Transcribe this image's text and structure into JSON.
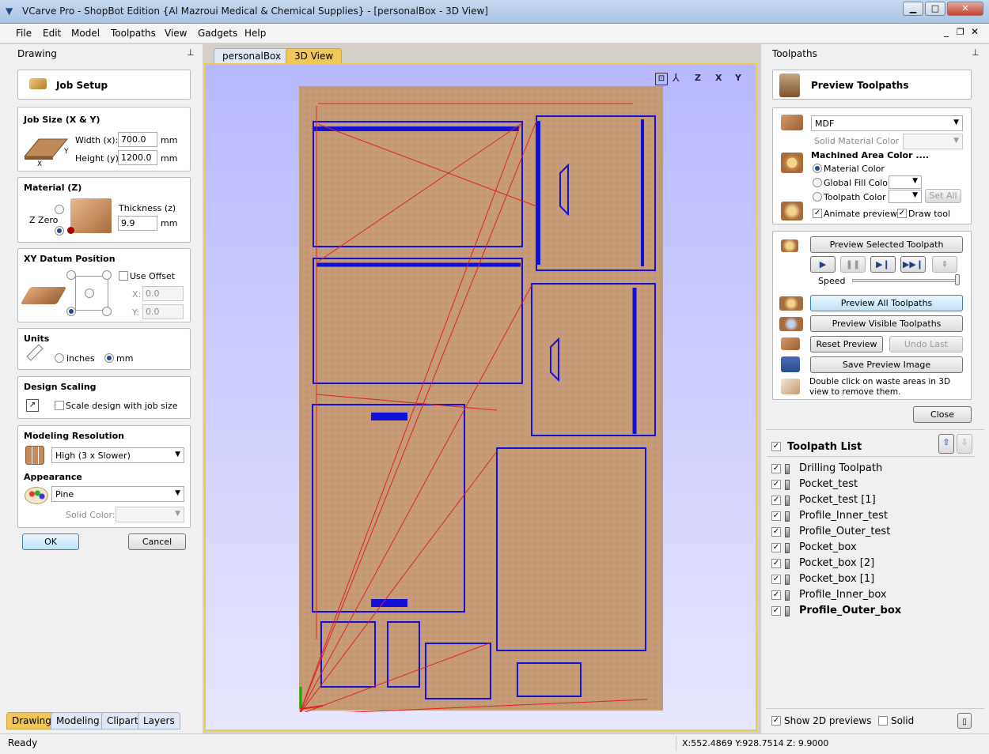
{
  "window": {
    "title": "VCarve Pro - ShopBot Edition {Al Mazroui Medical & Chemical Supplies} - [personalBox - 3D View]"
  },
  "menu": [
    "File",
    "Edit",
    "Model",
    "Toolpaths",
    "View",
    "Gadgets",
    "Help"
  ],
  "drawing_panel": {
    "title": "Drawing",
    "job_setup": "Job Setup",
    "job_size": {
      "heading": "Job Size (X & Y)",
      "width_label": "Width (x):",
      "width_value": "700.0",
      "height_label": "Height (y):",
      "height_value": "1200.0",
      "unit": "mm",
      "x_label": "X",
      "y_label": "Y"
    },
    "material": {
      "heading": "Material (Z)",
      "thickness_label": "Thickness (z)",
      "thickness_value": "9.9",
      "unit": "mm",
      "zzero_label": "Z Zero"
    },
    "datum": {
      "heading": "XY Datum Position",
      "use_offset": "Use Offset",
      "x_label": "X:",
      "x_value": "0.0",
      "y_label": "Y:",
      "y_value": "0.0"
    },
    "units": {
      "heading": "Units",
      "inches": "inches",
      "mm": "mm"
    },
    "scaling": {
      "heading": "Design Scaling",
      "label": "Scale design with job size"
    },
    "resolution": {
      "heading": "Modeling Resolution",
      "value": "High (3 x Slower)"
    },
    "appearance": {
      "heading": "Appearance",
      "value": "Pine",
      "solid_color_label": "Solid Color:"
    },
    "ok": "OK",
    "cancel": "Cancel"
  },
  "bottom_tabs": [
    "Drawing",
    "Modeling",
    "Clipart",
    "Layers"
  ],
  "doc_tabs": [
    "personalBox",
    "3D View"
  ],
  "view_toolbar": [
    "Z",
    "X",
    "Y"
  ],
  "toolpaths_panel": {
    "title": "Toolpaths",
    "preview_title": "Preview Toolpaths",
    "material": "MDF",
    "solid_material_color": "Solid Material Color",
    "machined_area_color": "Machined Area Color ....",
    "material_color": "Material Color",
    "global_fill_color": "Global Fill Color",
    "toolpath_color": "Toolpath Color",
    "set_all": "Set All",
    "animate_preview": "Animate preview",
    "draw_tool": "Draw tool",
    "preview_selected": "Preview Selected Toolpath",
    "speed": "Speed",
    "speed_value": 1.0,
    "preview_all": "Preview All Toolpaths",
    "preview_visible": "Preview Visible Toolpaths",
    "reset_preview": "Reset Preview",
    "undo_last": "Undo Last",
    "save_preview": "Save Preview Image",
    "hint": "Double click on waste areas in 3D view to remove them.",
    "close": "Close",
    "list_title": "Toolpath List",
    "toolpaths": [
      "Drilling Toolpath",
      "Pocket_test",
      "Pocket_test [1]",
      "Profile_Inner_test",
      "Profile_Outer_test",
      "Pocket_box",
      "Pocket_box [2]",
      "Pocket_box [1]",
      "Profile_Inner_box",
      "Profile_Outer_box"
    ],
    "show_2d": "Show 2D previews",
    "solid": "Solid"
  },
  "status": {
    "left": "Ready",
    "coords": "X:552.4869 Y:928.7514 Z: 9.9000"
  },
  "colors": {
    "accent": "#f3c65a",
    "toolpath_blue": "#1010d8",
    "rapid_red": "#e02020",
    "material": "#c59a76"
  }
}
